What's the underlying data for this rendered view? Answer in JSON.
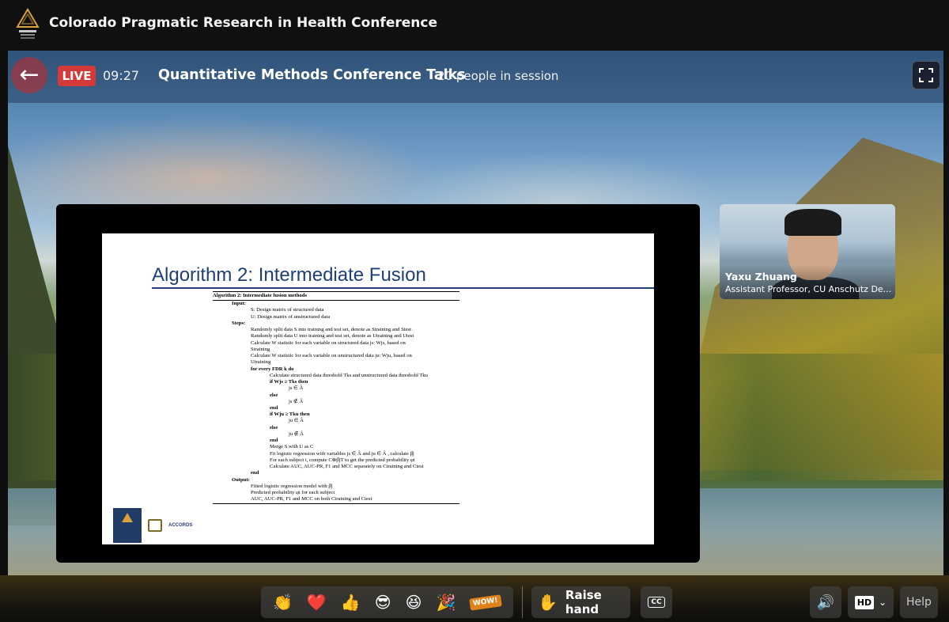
{
  "header": {
    "conference_title": "Colorado Pragmatic Research in Health Conference",
    "logo_icon": "conference-logo-icon"
  },
  "session": {
    "live_label": "LIVE",
    "timer": "09:27",
    "title": "Quantitative Methods Conference Talks",
    "people_count": "20 people in session",
    "back_icon": "arrow-left-icon",
    "fullscreen_icon": "fullscreen-icon"
  },
  "slide": {
    "title": "Algorithm 2: Intermediate Fusion",
    "algorithm_header": "Algorithm 2: Intermediate fusion methods",
    "lines": [
      {
        "indent": 1,
        "text": "Input:",
        "bold": true
      },
      {
        "indent": 2,
        "text": "S: Design matrix of structured data"
      },
      {
        "indent": 2,
        "text": "U: Design matrix of unstructured data"
      },
      {
        "indent": 1,
        "text": "Steps:",
        "bold": true
      },
      {
        "indent": 2,
        "text": "Randomly split data S into training and test set, denote as Straining and Stest"
      },
      {
        "indent": 2,
        "text": "Randomly split data U into training and test set, denote as Utraining and Utest"
      },
      {
        "indent": 2,
        "text": "Calculate W statistic for each variable on structured data js: Wjs, based on"
      },
      {
        "indent": 2,
        "text": "Straining"
      },
      {
        "indent": 2,
        "text": "Calculate W statistic for each variable on unstructured data ju: Wju, based on"
      },
      {
        "indent": 2,
        "text": "Utraining"
      },
      {
        "indent": 2,
        "text": "for every FDR k do",
        "bold": true
      },
      {
        "indent": 3,
        "text": "Calculate structured data threshold Tks and unstructured data threshold Tku"
      },
      {
        "indent": 3,
        "text": "if Wjs ≥ Tks then",
        "bold": true
      },
      {
        "indent": 4,
        "text": "js ∈ Â"
      },
      {
        "indent": 3,
        "text": "else",
        "bold": true
      },
      {
        "indent": 4,
        "text": "js ∉ Â"
      },
      {
        "indent": 3,
        "text": "end",
        "bold": true
      },
      {
        "indent": 3,
        "text": "if Wju ≥ Tku then",
        "bold": true
      },
      {
        "indent": 4,
        "text": "ju ∈ Â"
      },
      {
        "indent": 3,
        "text": "else",
        "bold": true
      },
      {
        "indent": 4,
        "text": "ju ∉ Â"
      },
      {
        "indent": 3,
        "text": "end",
        "bold": true
      },
      {
        "indent": 3,
        "text": "Merge S with U as C"
      },
      {
        "indent": 3,
        "text": "Fit logistic regression with variables js ∈ Â and ju ∈ Â , calculate β̂j"
      },
      {
        "indent": 3,
        "text": "For each subject i, compute C⊗β̂jT to get the predicted probability φi"
      },
      {
        "indent": 3,
        "text": "Calculate AUC, AUC-PR, F1 and MCC separately on Ctraining and Ctest"
      },
      {
        "indent": 2,
        "text": "end",
        "bold": true
      },
      {
        "indent": 1,
        "text": "Output:",
        "bold": true
      },
      {
        "indent": 2,
        "text": "Fitted logistic regression model with β̂j"
      },
      {
        "indent": 2,
        "text": "Predicted probability φi for each subject"
      },
      {
        "indent": 2,
        "text": "AUC, AUC-PR, F1 and MCC on both Ctraining and Ctest"
      }
    ],
    "logos_label": "ACCORDS"
  },
  "participant": {
    "name": "Yaxu Zhuang",
    "role": "Assistant Professor, CU Anschutz De..."
  },
  "controls": {
    "reactions": [
      {
        "name": "clap-reaction",
        "glyph": "👏"
      },
      {
        "name": "heart-reaction",
        "glyph": "❤️"
      },
      {
        "name": "thumbs-up-reaction",
        "glyph": "👍"
      },
      {
        "name": "cool-reaction",
        "glyph": "😎"
      },
      {
        "name": "laugh-reaction",
        "glyph": "😆"
      },
      {
        "name": "party-reaction",
        "glyph": "🎉"
      },
      {
        "name": "wow-reaction",
        "glyph": "WOW!"
      }
    ],
    "raise_hand_label": "Raise hand",
    "cc_label": "CC",
    "hd_label": "HD",
    "help_label": "Help"
  },
  "colors": {
    "live": "#d43a3a",
    "slide_title": "#1e3f77"
  }
}
